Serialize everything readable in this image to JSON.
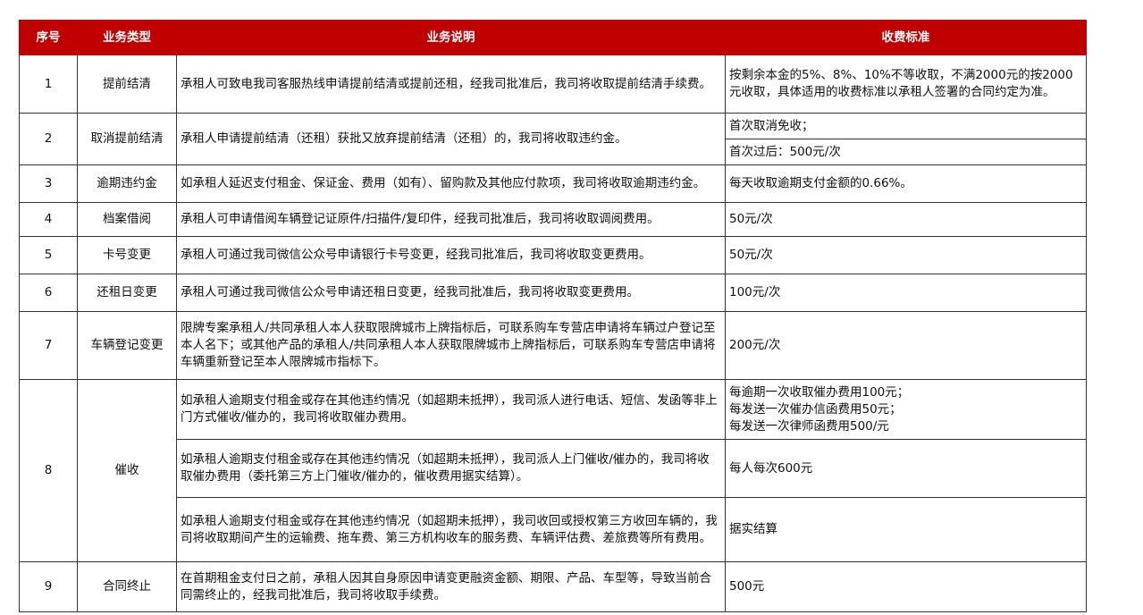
{
  "headers": [
    "序号",
    "业务类型",
    "业务说明",
    "收费标准"
  ],
  "rows": [
    {
      "no": "1",
      "type": "提前结清",
      "desc": "承租人可致电我司客服热线申请提前结清或提前还租，经我司批准后，我司将收取提前结清手续费。",
      "fee": "按剩余本金的5%、8%、10%不等收取，不满2000元的按2000元收取，具体适用的收费标准以承租人签署的合同约定为准。"
    },
    {
      "no": "2",
      "type": "取消提前结清",
      "desc": "承租人申请提前结清（还租）获批又放弃提前结清（还租）的，我司将收取违约金。",
      "fee_a": "首次取消免收；",
      "fee_b": "首次过后：500元/次"
    },
    {
      "no": "3",
      "type": "逾期违约金",
      "desc": "如承租人延迟支付租金、保证金、费用（如有）、留购款及其他应付款项，我司将收取逾期违约金。",
      "fee": "每天收取逾期支付金额的0.66%。"
    },
    {
      "no": "4",
      "type": "档案借阅",
      "desc": "承租人可申请借阅车辆登记证原件/扫描件/复印件，经我司批准后，我司将收取调阅费用。",
      "fee": "50元/次"
    },
    {
      "no": "5",
      "type": "卡号变更",
      "desc": "承租人可通过我司微信公众号申请银行卡号变更，经我司批准后，我司将收取变更费用。",
      "fee": "50元/次"
    },
    {
      "no": "6",
      "type": "还租日变更",
      "desc": "承租人可通过我司微信公众号申请还租日变更，经我司批准后，我司将收取变更费用。",
      "fee": "100元/次"
    },
    {
      "no": "7",
      "type": "车辆登记变更",
      "desc": "限牌专案承租人/共同承租人本人获取限牌城市上牌指标后，可联系购车专营店申请将车辆过户登记至本人名下；或其他产品的承租人/共同承租人本人获取限牌城市上牌指标后，可联系购车专营店申请将车辆重新登记至本人限牌城市指标下。",
      "fee": "200元/次"
    },
    {
      "no": "8",
      "type": "催收",
      "sub": [
        {
          "desc": "如承租人逾期支付租金或存在其他违约情况（如超期未抵押），我司派人进行电话、短信、发函等非上门方式催收/催办的，我司将收取催办费用。",
          "fee_lines": [
            "每逾期一次收取催办费用100元；",
            "每发送一次催办信函费用50元；",
            "每发送一次律师函费用500/元"
          ]
        },
        {
          "desc": "如承租人逾期支付租金或存在其他违约情况（如超期未抵押），我司派人上门催收/催办的，我司将收取催办费用（委托第三方上门催收/催办的，催收费用据实结算）。",
          "fee": "每人每次600元"
        },
        {
          "desc": "如承租人逾期支付租金或存在其他违约情况（如超期未抵押），我司收回或授权第三方收回车辆的，我司将收取期间产生的运输费、拖车费、第三方机构收车的服务费、车辆评估费、差旅费等所有费用。",
          "fee": "据实结算"
        }
      ]
    },
    {
      "no": "9",
      "type": "合同终止",
      "desc": "在首期租金支付日之前，承租人因其自身原因申请变更融资金额、期限、产品、车型等，导致当前合同需终止的，经我司批准后，我司将收取手续费。",
      "fee": "500元"
    }
  ]
}
